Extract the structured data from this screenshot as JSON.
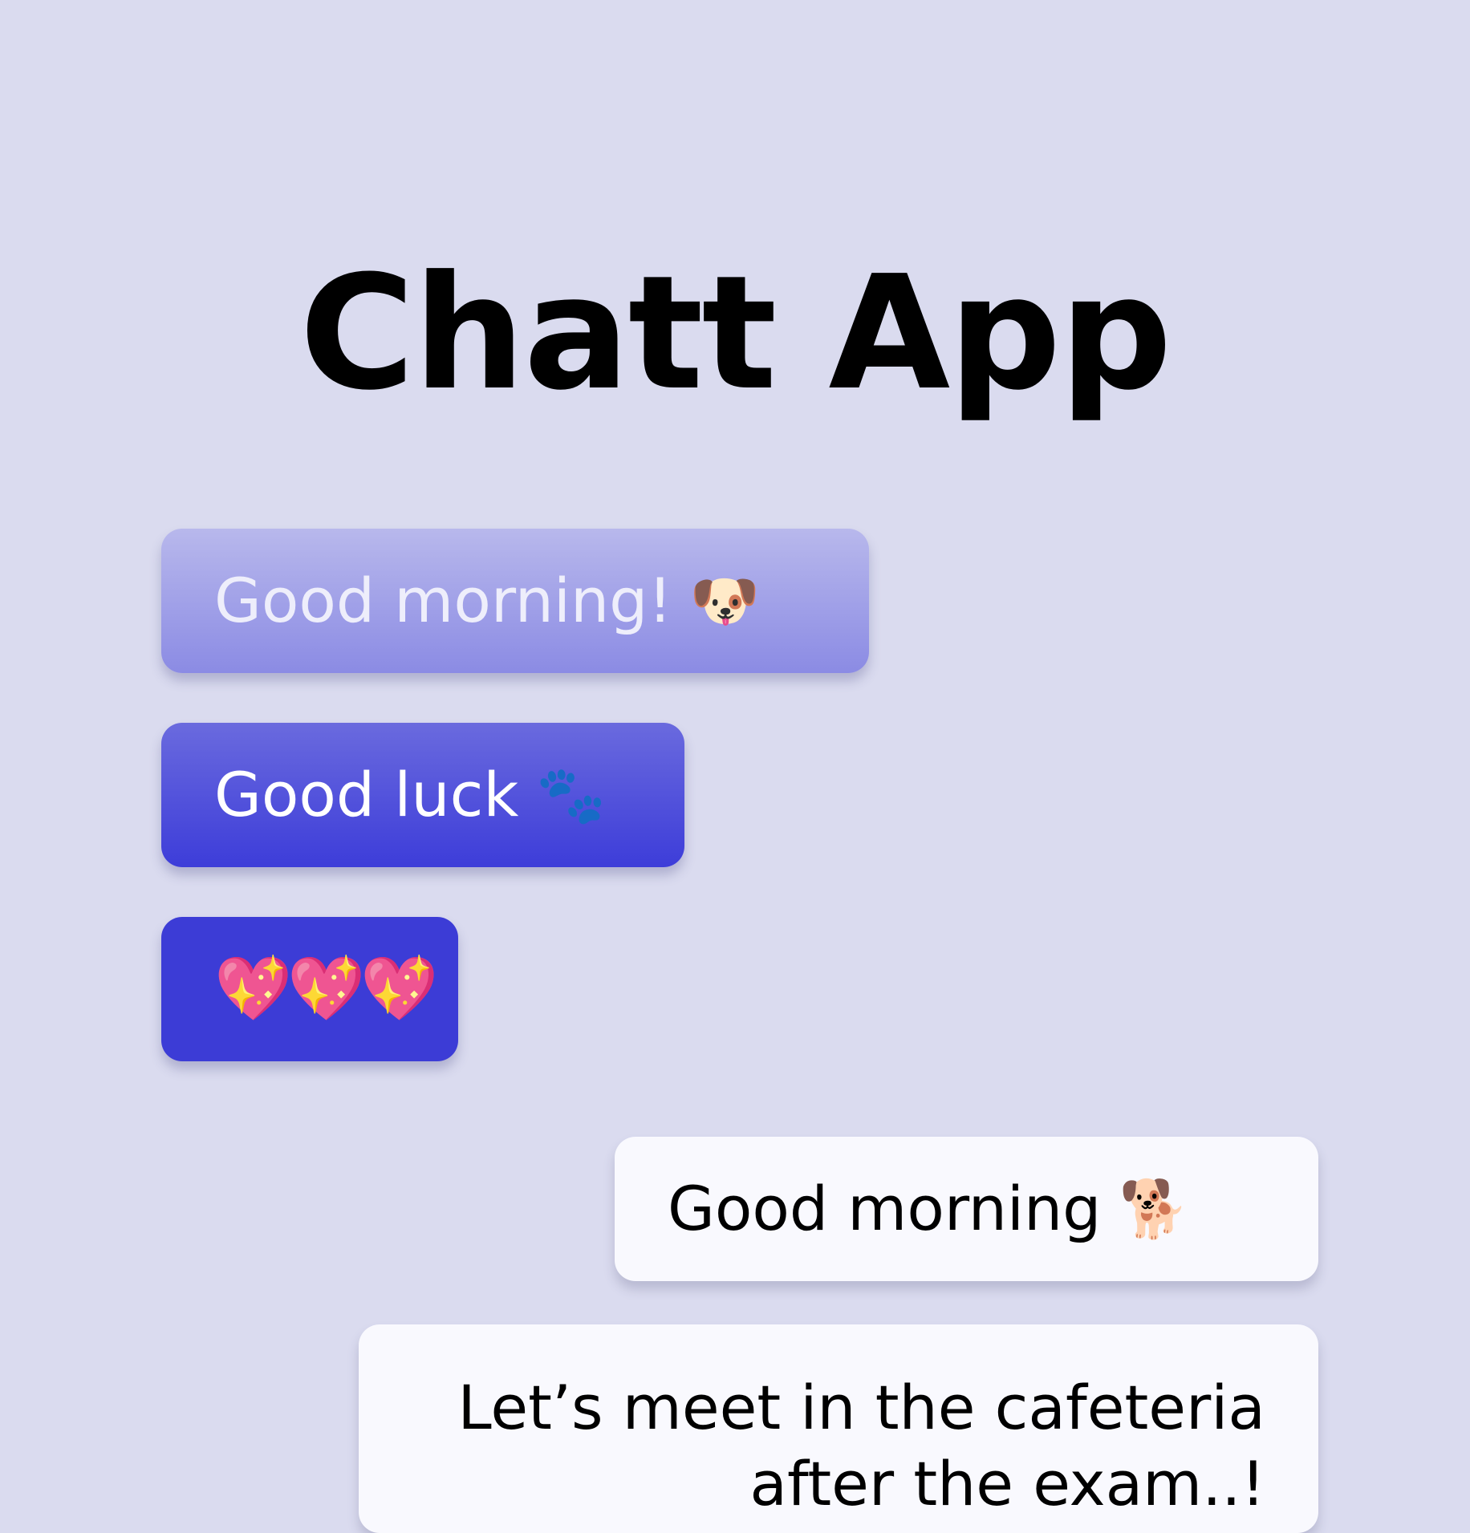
{
  "app": {
    "title": "Chatt App"
  },
  "messages": {
    "received": [
      {
        "text": "Good morning!",
        "emoji": "🐶"
      },
      {
        "text": "Good luck",
        "emoji": "🐾"
      },
      {
        "text": "",
        "emoji": "💖💖💖"
      }
    ],
    "sent": [
      {
        "text": "Good morning",
        "emoji": "🐕"
      },
      {
        "text": "Let’s meet in the cafeteria after the exam..!",
        "emoji": ""
      }
    ]
  },
  "colors": {
    "background": "#dadbef",
    "received_light": "#a8a8e9",
    "received_mid": "#5656dc",
    "received_dark": "#3c3cd6",
    "sent": "#f9f9fe"
  }
}
